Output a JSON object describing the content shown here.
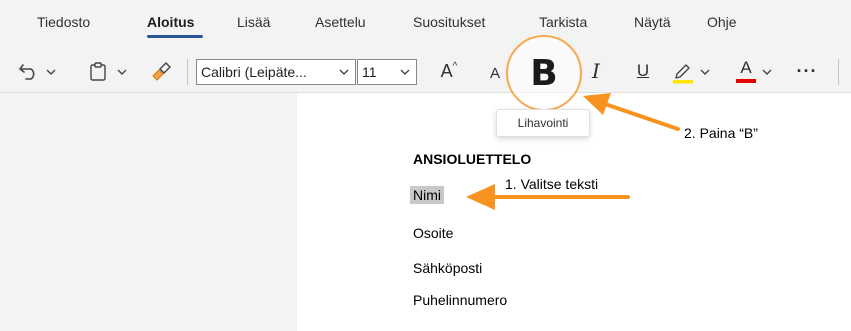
{
  "tabs": [
    {
      "label": "Tiedosto"
    },
    {
      "label": "Aloitus"
    },
    {
      "label": "Lisää"
    },
    {
      "label": "Asettelu"
    },
    {
      "label": "Suositukset"
    },
    {
      "label": "Tarkista"
    },
    {
      "label": "Näytä"
    },
    {
      "label": "Ohje"
    }
  ],
  "toolbar": {
    "undo_icon": "undo-icon",
    "paste_icon": "clipboard-icon",
    "format_painter_icon": "format-painter-icon",
    "font_name": "Calibri (Leipäte...",
    "font_size": "11",
    "grow_font": "A",
    "shrink_font": "A",
    "bold": "B",
    "italic": "I",
    "underline": "U",
    "font_color": "A",
    "more": "···",
    "bold_tooltip": "Lihavointi"
  },
  "document": {
    "lines": [
      "ANSIOLUETTELO",
      "Nimi",
      "Osoite",
      "Sähköposti",
      "Puhelinnumero"
    ]
  },
  "annotations": {
    "step1": "1. Valitse teksti",
    "step2": "2. Paina “B”",
    "arrow_color": "#f7931e"
  },
  "colors": {
    "accent": "#2b579a",
    "highlight_marker": "#ffe500",
    "font_color_bar": "#e00000"
  }
}
